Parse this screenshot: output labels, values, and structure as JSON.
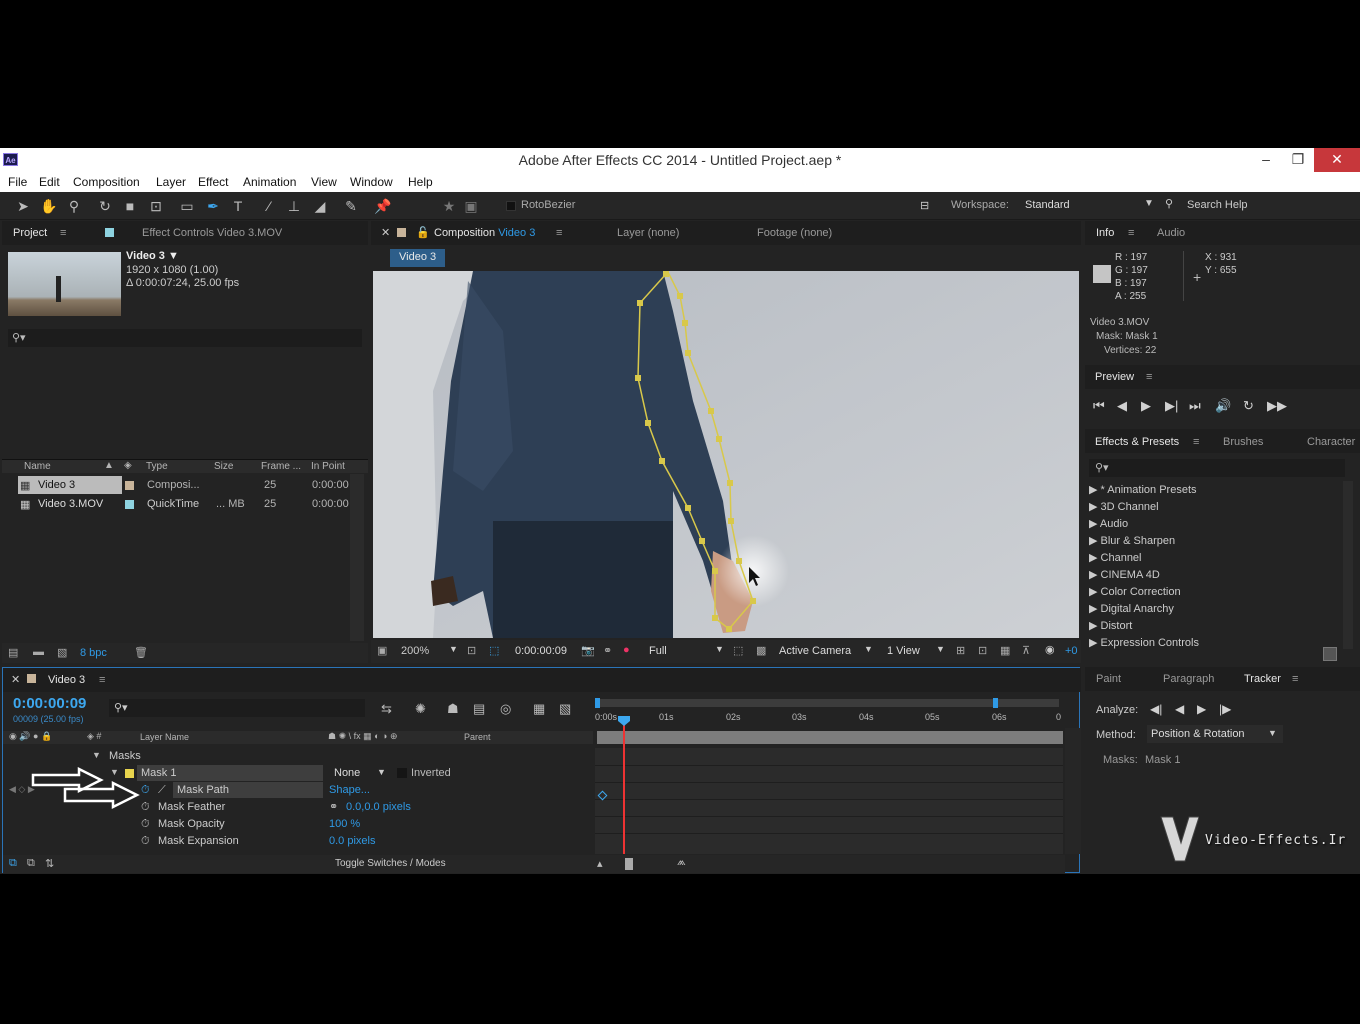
{
  "window": {
    "title": "Adobe After Effects CC 2014 - Untitled Project.aep *",
    "app_icon": "Ae",
    "min": "–",
    "restore": "❐",
    "close": "✕"
  },
  "menu": [
    "File",
    "Edit",
    "Composition",
    "Layer",
    "Effect",
    "Animation",
    "View",
    "Window",
    "Help"
  ],
  "toolbar": {
    "rotobezier": "RotoBezier",
    "workspace_label": "Workspace:",
    "workspace_value": "Standard",
    "search_help": "Search Help"
  },
  "project": {
    "tab": "Project",
    "effect_controls": "Effect Controls Video 3.MOV",
    "comp_name": "Video 3 ▼",
    "comp_res": "1920 x 1080 (1.00)",
    "comp_dur": "Δ 0:00:07:24, 25.00 fps",
    "columns": [
      "Name",
      "Type",
      "Size",
      "Frame ...",
      "In Point"
    ],
    "items": [
      {
        "name": "Video 3",
        "type": "Composi...",
        "size": "",
        "fr": "25",
        "in": "0:00:00"
      },
      {
        "name": "Video 3.MOV",
        "type": "QuickTime",
        "size": "... MB",
        "fr": "25",
        "in": "0:00:00"
      }
    ],
    "bpc": "8 bpc"
  },
  "viewer": {
    "tab_comp": "Composition",
    "tab_comp_name": "Video 3",
    "tab_layer": "Layer (none)",
    "tab_footage": "Footage (none)",
    "comp_chip": "Video 3",
    "zoom": "200%",
    "timecode": "0:00:00:09",
    "resolution": "Full",
    "camera": "Active Camera",
    "views": "1 View",
    "exposure": "+0"
  },
  "info": {
    "tab": "Info",
    "tab2": "Audio",
    "r": "R : 197",
    "g": "G : 197",
    "b": "B : 197",
    "a": "A : 255",
    "x": "X : 931",
    "y": "Y : 655",
    "l1": "Video 3.MOV",
    "l2": "Mask: Mask 1",
    "l3": "Vertices: 22",
    "swatch": "#c5c5c5"
  },
  "preview": {
    "tab": "Preview"
  },
  "effects": {
    "tab": "Effects & Presets",
    "tab2": "Brushes",
    "tab3": "Character",
    "items": [
      "* Animation Presets",
      "3D Channel",
      "Audio",
      "Blur & Sharpen",
      "Channel",
      "CINEMA 4D",
      "Color Correction",
      "Digital Anarchy",
      "Distort",
      "Expression Controls"
    ]
  },
  "tracker": {
    "tab1": "Paint",
    "tab2": "Paragraph",
    "tab3": "Tracker",
    "analyze": "Analyze:",
    "method": "Method:",
    "method_value": "Position & Rotation",
    "masks": "Masks:",
    "masks_value": "Mask 1"
  },
  "timeline": {
    "tab": "Video 3",
    "timecode": "0:00:00:09",
    "frames": "00009 (25.00 fps)",
    "col_layer": "Layer Name",
    "col_parent": "Parent",
    "ruler": [
      "0:00s",
      "01s",
      "02s",
      "03s",
      "04s",
      "05s",
      "06s",
      "0"
    ],
    "masks": "Masks",
    "mask1": "Mask 1",
    "mode": "None",
    "inverted": "Inverted",
    "props": [
      {
        "name": "Mask Path",
        "value": "Shape..."
      },
      {
        "name": "Mask Feather",
        "value": "0.0,0.0 pixels"
      },
      {
        "name": "Mask Opacity",
        "value": "100 %"
      },
      {
        "name": "Mask Expansion",
        "value": "0.0 pixels"
      }
    ],
    "toggle": "Toggle Switches / Modes"
  },
  "watermark": "Video-Effects.Ir"
}
